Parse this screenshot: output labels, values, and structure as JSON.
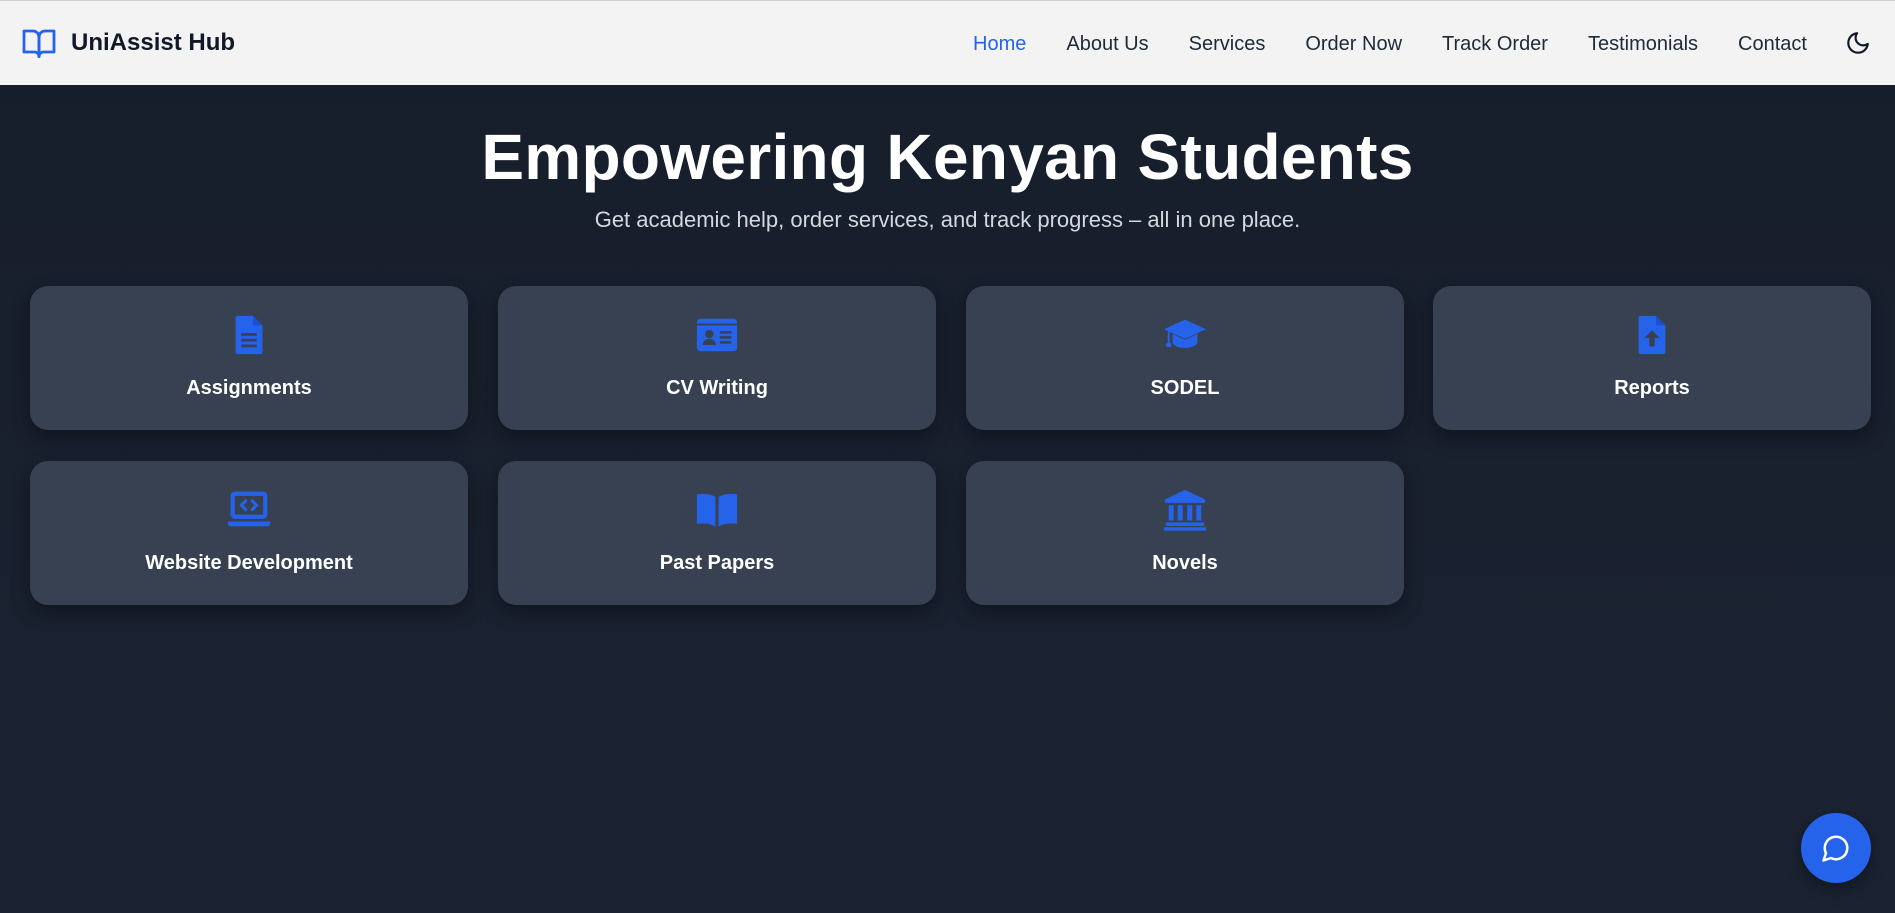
{
  "brand": {
    "name": "UniAssist Hub",
    "icon": "open-book-icon"
  },
  "nav": {
    "items": [
      {
        "label": "Home",
        "active": true
      },
      {
        "label": "About Us",
        "active": false
      },
      {
        "label": "Services",
        "active": false
      },
      {
        "label": "Order Now",
        "active": false
      },
      {
        "label": "Track Order",
        "active": false
      },
      {
        "label": "Testimonials",
        "active": false
      },
      {
        "label": "Contact",
        "active": false
      }
    ],
    "theme_toggle_icon": "moon-icon"
  },
  "hero": {
    "title": "Empowering Kenyan Students",
    "subtitle": "Get academic help, order services, and track progress – all in one place."
  },
  "services": [
    {
      "label": "Assignments",
      "icon": "document-icon"
    },
    {
      "label": "CV Writing",
      "icon": "id-card-icon"
    },
    {
      "label": "SODEL",
      "icon": "graduation-cap-icon"
    },
    {
      "label": "Reports",
      "icon": "file-upload-icon"
    },
    {
      "label": "Website Development",
      "icon": "laptop-code-icon"
    },
    {
      "label": "Past Papers",
      "icon": "book-open-icon"
    },
    {
      "label": "Novels",
      "icon": "landmark-icon"
    }
  ],
  "chat": {
    "icon": "chat-bubble-icon"
  },
  "colors": {
    "accent": "#2563eb",
    "card_bg": "#374151",
    "page_bg": "#161d2b",
    "navbar_bg": "#f3f3f3"
  }
}
